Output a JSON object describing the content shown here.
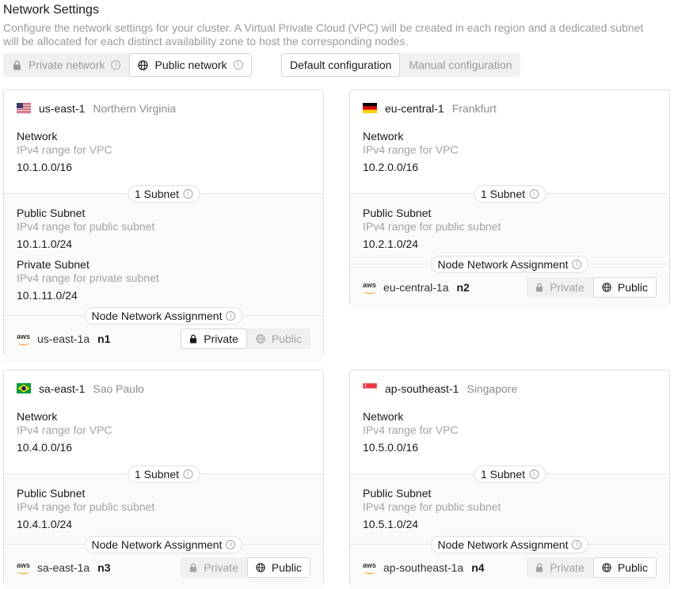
{
  "header": {
    "title": "Network Settings",
    "description": "Configure the network settings for your cluster. A Virtual Private Cloud (VPC) will be created in each region and a dedicated subnet will be allocated for each distinct availability zone to host the corresponding nodes."
  },
  "network_type": {
    "options": [
      {
        "label": "Private network",
        "icon": "lock-icon",
        "active": false
      },
      {
        "label": "Public network",
        "icon": "globe-icon",
        "active": true
      }
    ]
  },
  "config_mode": {
    "options": [
      {
        "label": "Default configuration",
        "active": true
      },
      {
        "label": "Manual configuration",
        "active": false
      }
    ]
  },
  "labels": {
    "network": "Network",
    "vpc_hint": "IPv4 range for VPC",
    "public_subnet": "Public Subnet",
    "public_hint": "IPv4 range for public subnet",
    "private_subnet": "Private Subnet",
    "private_hint": "IPv4 range for private subnet",
    "subnet_count": "1 Subnet",
    "node_assignment": "Node Network Assignment",
    "private": "Private",
    "public": "Public",
    "aws": "aws"
  },
  "regions": [
    {
      "code": "us-east-1",
      "name": "Northern Virginia",
      "flag": "us",
      "vpc": "10.1.0.0/16",
      "public_subnet": "10.1.1.0/24",
      "private_subnet": "10.1.11.0/24",
      "az": "us-east-1a",
      "node": "n1",
      "assignment": "Private"
    },
    {
      "code": "eu-central-1",
      "name": "Frankfurt",
      "flag": "de",
      "vpc": "10.2.0.0/16",
      "public_subnet": "10.2.1.0/24",
      "az": "eu-central-1a",
      "node": "n2",
      "assignment": "Public"
    },
    {
      "code": "sa-east-1",
      "name": "Sao Paulo",
      "flag": "br",
      "vpc": "10.4.0.0/16",
      "public_subnet": "10.4.1.0/24",
      "az": "sa-east-1a",
      "node": "n3",
      "assignment": "Public"
    },
    {
      "code": "ap-southeast-1",
      "name": "Singapore",
      "flag": "sg",
      "vpc": "10.5.0.0/16",
      "public_subnet": "10.5.1.0/24",
      "az": "ap-southeast-1a",
      "node": "n4",
      "assignment": "Public"
    }
  ],
  "colors": {
    "accent_text": "#1a1a1a",
    "muted_text": "#9a9a9a",
    "aws_orange": "#f29100"
  }
}
